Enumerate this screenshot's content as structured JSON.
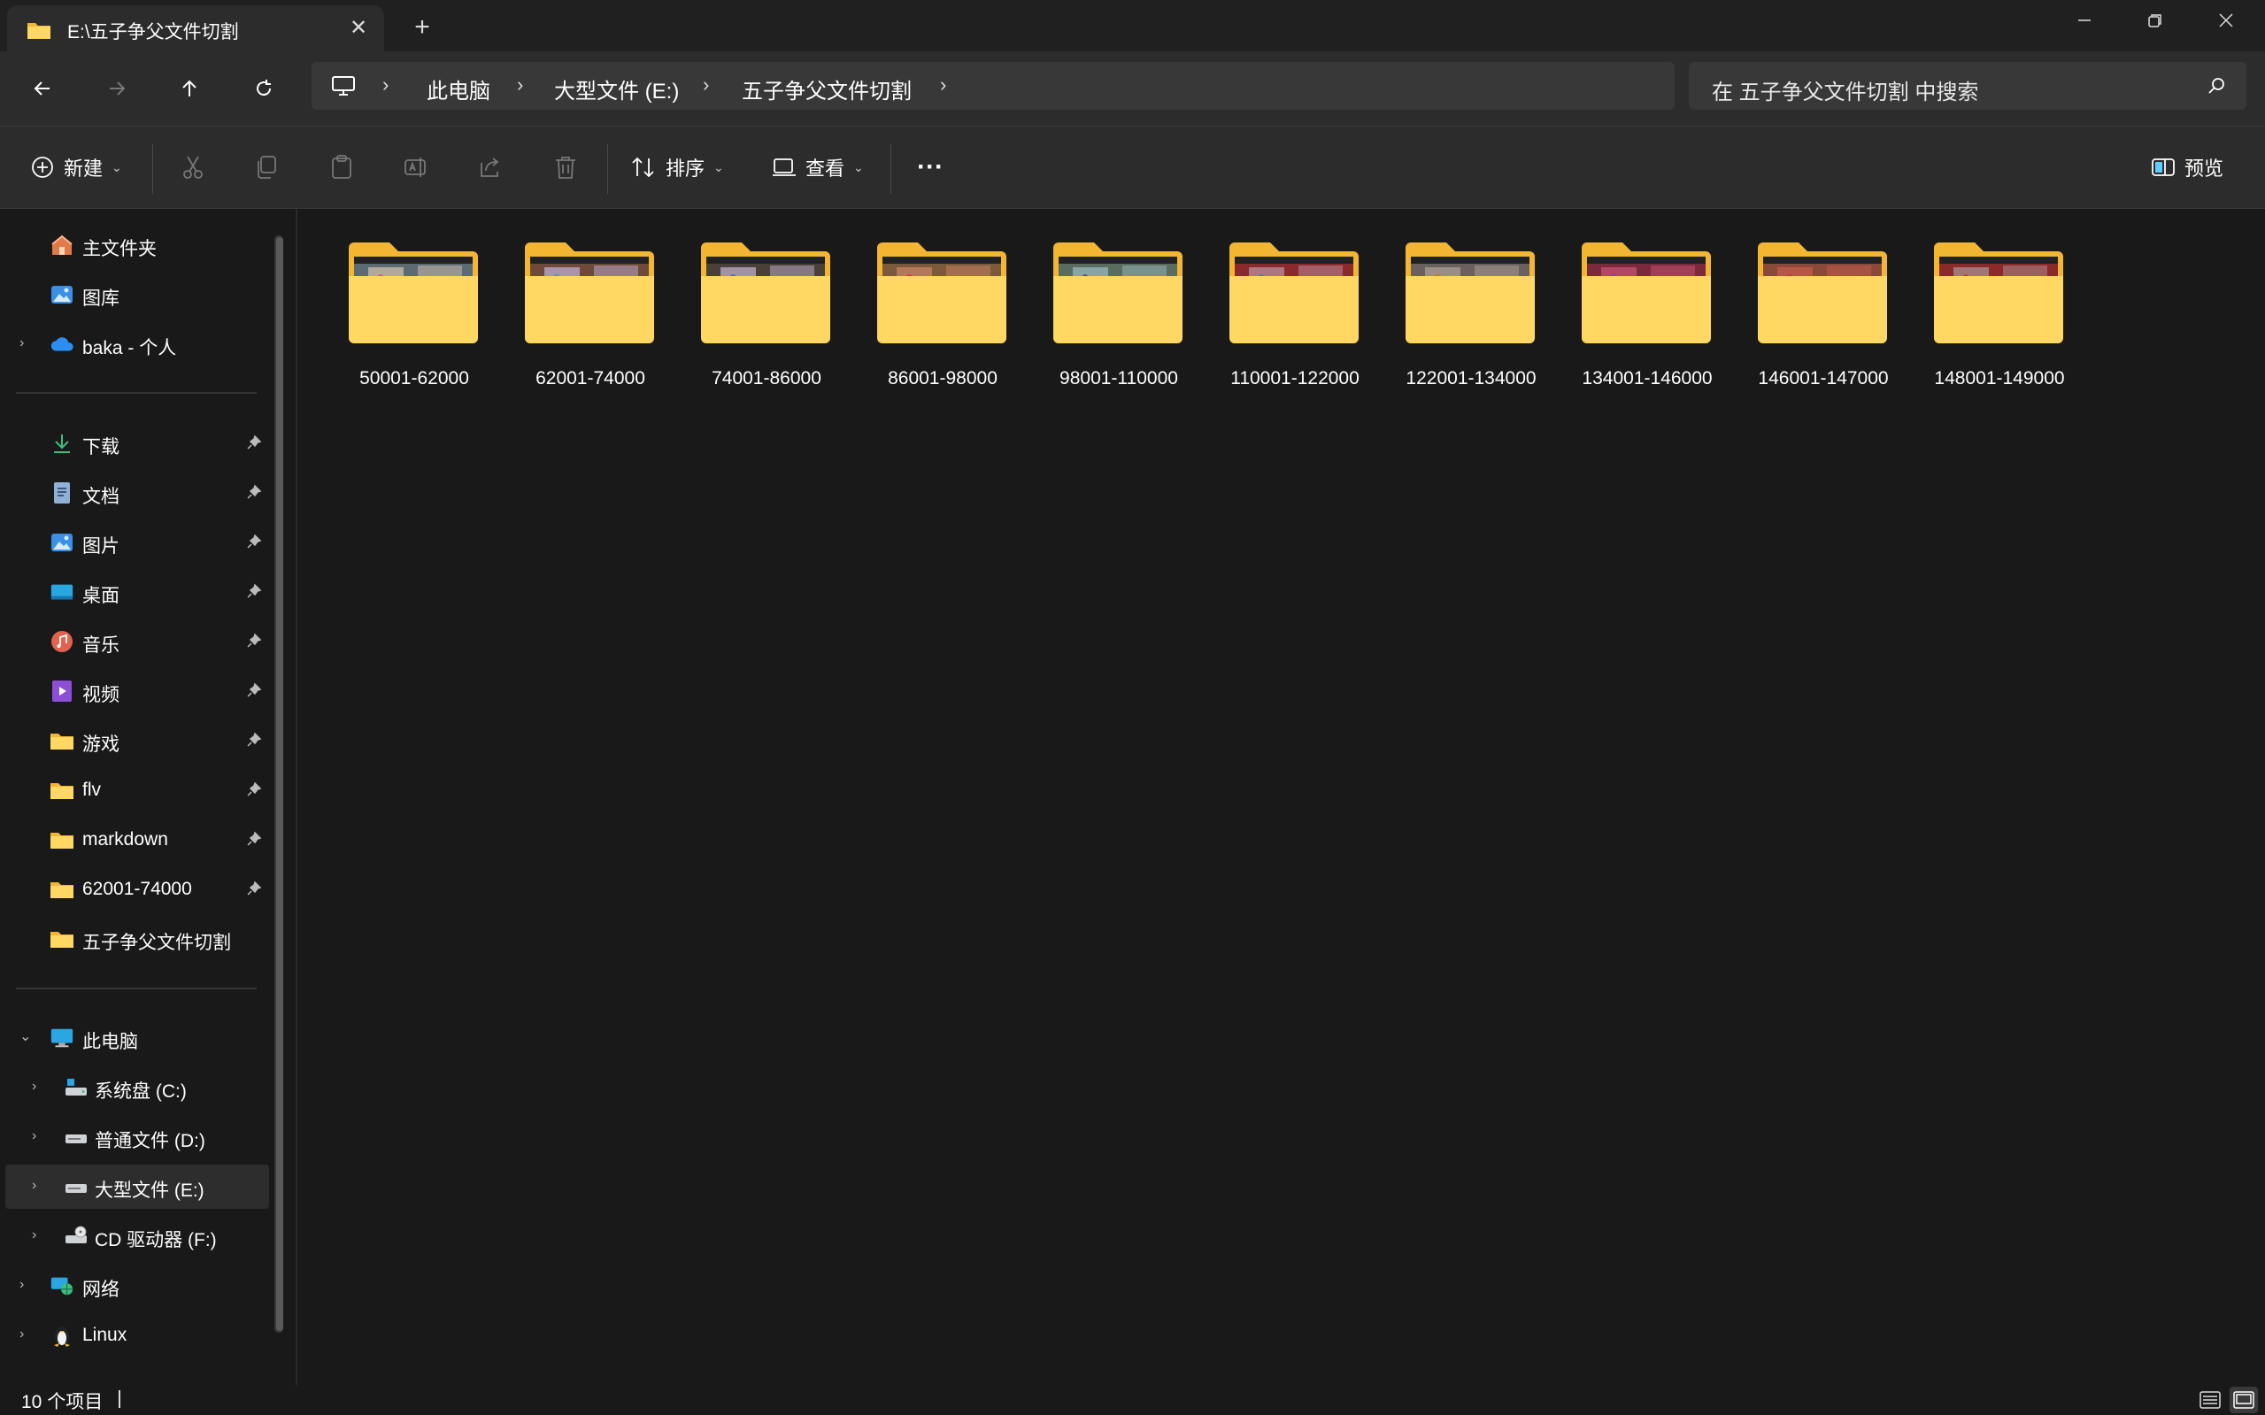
{
  "tab": {
    "title": "E:\\五子争父文件切割"
  },
  "address": {
    "crumbs": [
      "此电脑",
      "大型文件 (E:)",
      "五子争父文件切割"
    ]
  },
  "search": {
    "placeholder": "在 五子争父文件切割 中搜索"
  },
  "commands": {
    "new_label": "新建",
    "sort_label": "排序",
    "view_label": "查看",
    "more_label": "···",
    "preview_label": "预览"
  },
  "sidebar": {
    "top_items": [
      {
        "label": "主文件夹",
        "icon": "home-icon"
      },
      {
        "label": "图库",
        "icon": "gallery-icon"
      },
      {
        "label": "baka - 个人",
        "icon": "onedrive-icon"
      }
    ],
    "quick_access": [
      {
        "label": "下载",
        "icon": "download-icon"
      },
      {
        "label": "文档",
        "icon": "document-icon"
      },
      {
        "label": "图片",
        "icon": "pictures-icon"
      },
      {
        "label": "桌面",
        "icon": "desktop-icon"
      },
      {
        "label": "音乐",
        "icon": "music-icon"
      },
      {
        "label": "视频",
        "icon": "video-icon"
      },
      {
        "label": "游戏",
        "icon": "folder-icon"
      },
      {
        "label": "flv",
        "icon": "folder-icon"
      },
      {
        "label": "markdown",
        "icon": "folder-icon"
      },
      {
        "label": "62001-74000",
        "icon": "folder-icon"
      },
      {
        "label": "五子争父文件切割",
        "icon": "folder-icon"
      }
    ],
    "this_pc": {
      "label": "此电脑",
      "drives": [
        {
          "label": "系统盘 (C:)"
        },
        {
          "label": "普通文件 (D:)"
        },
        {
          "label": "大型文件 (E:)"
        },
        {
          "label": "CD 驱动器 (F:)"
        }
      ]
    },
    "network": "网络",
    "linux": "Linux"
  },
  "folders": [
    "50001-62000",
    "62001-74000",
    "74001-86000",
    "86001-98000",
    "98001-110000",
    "110001-122000",
    "122001-134000",
    "134001-146000",
    "146001-147000",
    "148001-149000"
  ],
  "status": {
    "item_count": "10 个项目"
  },
  "colors": {
    "folder_back": "#f2b632",
    "folder_front": "#ffd763",
    "accent": "#60cdff",
    "background": "#191919",
    "toolbar": "#2c2c2c"
  }
}
